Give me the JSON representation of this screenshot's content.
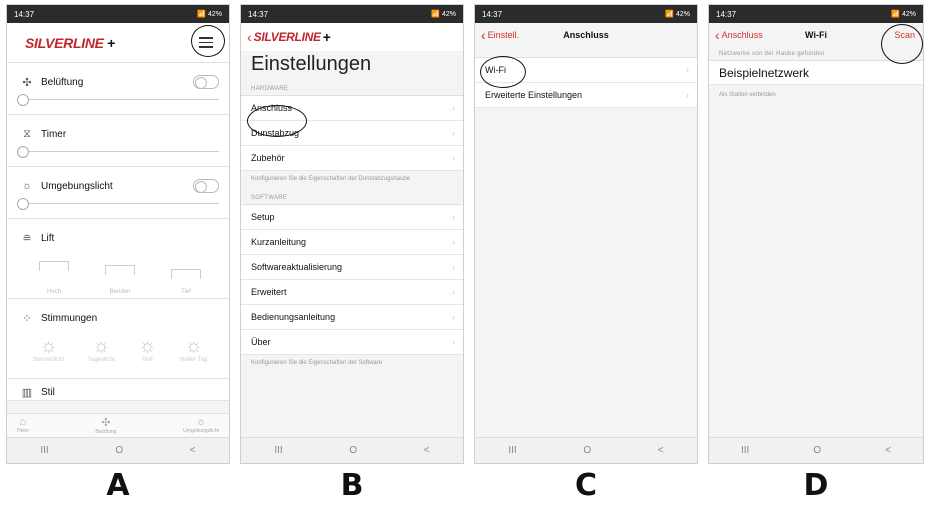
{
  "status": {
    "time": "14:37",
    "battery": "42%"
  },
  "screenA": {
    "brand": "SILVERLINE",
    "brand_plus": "+",
    "sections": {
      "ventilation": "Belüftung",
      "timer": "Timer",
      "ambient": "Umgebungslicht",
      "lift": "Lift",
      "moods": "Stimmungen",
      "style": "Stil"
    },
    "lift_options": [
      "Hoch",
      "Benden",
      "Tief"
    ],
    "mood_options": [
      "Sonnenlicht",
      "Tageslicht",
      "Hell",
      "Heller Tag"
    ],
    "tabs": [
      "Heim",
      "Belüftung",
      "Umgebungslicht"
    ]
  },
  "screenB": {
    "back_label": "SILVERLINE",
    "back_plus": "+",
    "title": "Einstellungen",
    "hardware_header": "HARDWARE",
    "hardware_items": [
      "Anschluss",
      "Dunstabzug",
      "Zubehör"
    ],
    "hardware_note": "Konfigurieren Sie die Eigenschaften der Dunstabzugshaube",
    "software_header": "SOFTWARE",
    "software_items": [
      "Setup",
      "Kurzanleitung",
      "Softwareaktualisierung",
      "Erweitert",
      "Bedienungsanleitung",
      "Über"
    ],
    "software_note": "Konfigurieren Sie die Eigenschaften der Software"
  },
  "screenC": {
    "back_label": "Einstell.",
    "title": "Anschluss",
    "items": [
      "Wi-Fi",
      "Erweiterte Einstellungen"
    ]
  },
  "screenD": {
    "back_label": "Anschluss",
    "title": "Wi-Fi",
    "scan_label": "Scan",
    "networks_header": "Netzwerke von der Haube gefunden",
    "network_name": "Beispielnetzwerk",
    "station_note": "Als Station verbinden"
  },
  "navbar": {
    "recents": "III",
    "home": "O",
    "back": "<"
  },
  "captions": [
    "A",
    "B",
    "C",
    "D"
  ]
}
